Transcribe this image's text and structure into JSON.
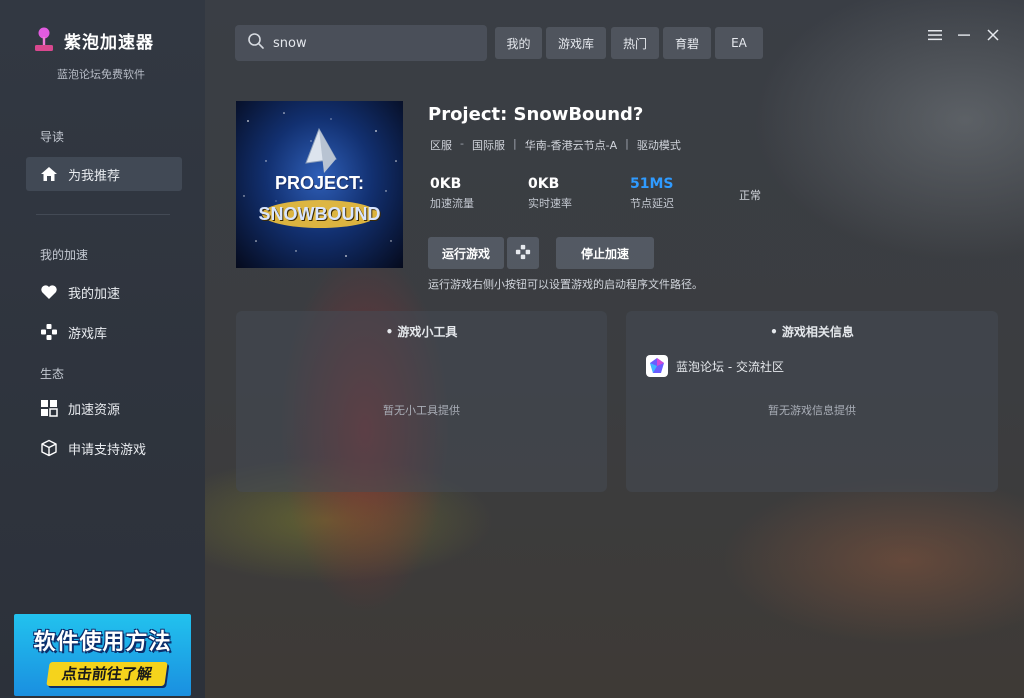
{
  "app": {
    "name": "紫泡加速器",
    "subtitle": "蓝泡论坛免费软件"
  },
  "sidebar": {
    "section_guide": "导读",
    "recommend": "为我推荐",
    "section_my": "我的加速",
    "my_accel": "我的加速",
    "game_library": "游戏库",
    "section_eco": "生态",
    "resources": "加速资源",
    "apply_support": "申请支持游戏",
    "promo_line1": "软件使用方法",
    "promo_line2": "点击前往了解"
  },
  "header": {
    "search_value": "snow",
    "tabs": [
      "我的",
      "游戏库",
      "热门",
      "育碧",
      "EA"
    ]
  },
  "game": {
    "title": "Project: SnowBound?",
    "cover_text_1": "PROJECT:",
    "cover_text_2": "SNOWBOUND",
    "region_label": "区服",
    "dash": "-",
    "region": "国际服",
    "node": "华南-香港云节点-A",
    "mode": "驱动模式",
    "traffic_value": "0KB",
    "traffic_label": "加速流量",
    "speed_value": "0KB",
    "speed_label": "实时速率",
    "latency_value": "51MS",
    "latency_label": "节点延迟",
    "status": "正常",
    "run_button": "运行游戏",
    "stop_button": "停止加速",
    "hint": "运行游戏右侧小按钮可以设置游戏的启动程序文件路径。"
  },
  "cards": {
    "tools_title": "• 游戏小工具",
    "tools_empty": "暂无小工具提供",
    "info_title": "• 游戏相关信息",
    "community_link": "蓝泡论坛 - 交流社区",
    "info_empty": "暂无游戏信息提供"
  },
  "colors": {
    "accent_blue": "#2f9bff",
    "sidebar_bg": "#2f353e",
    "promo_yellow": "#f5d31c"
  }
}
